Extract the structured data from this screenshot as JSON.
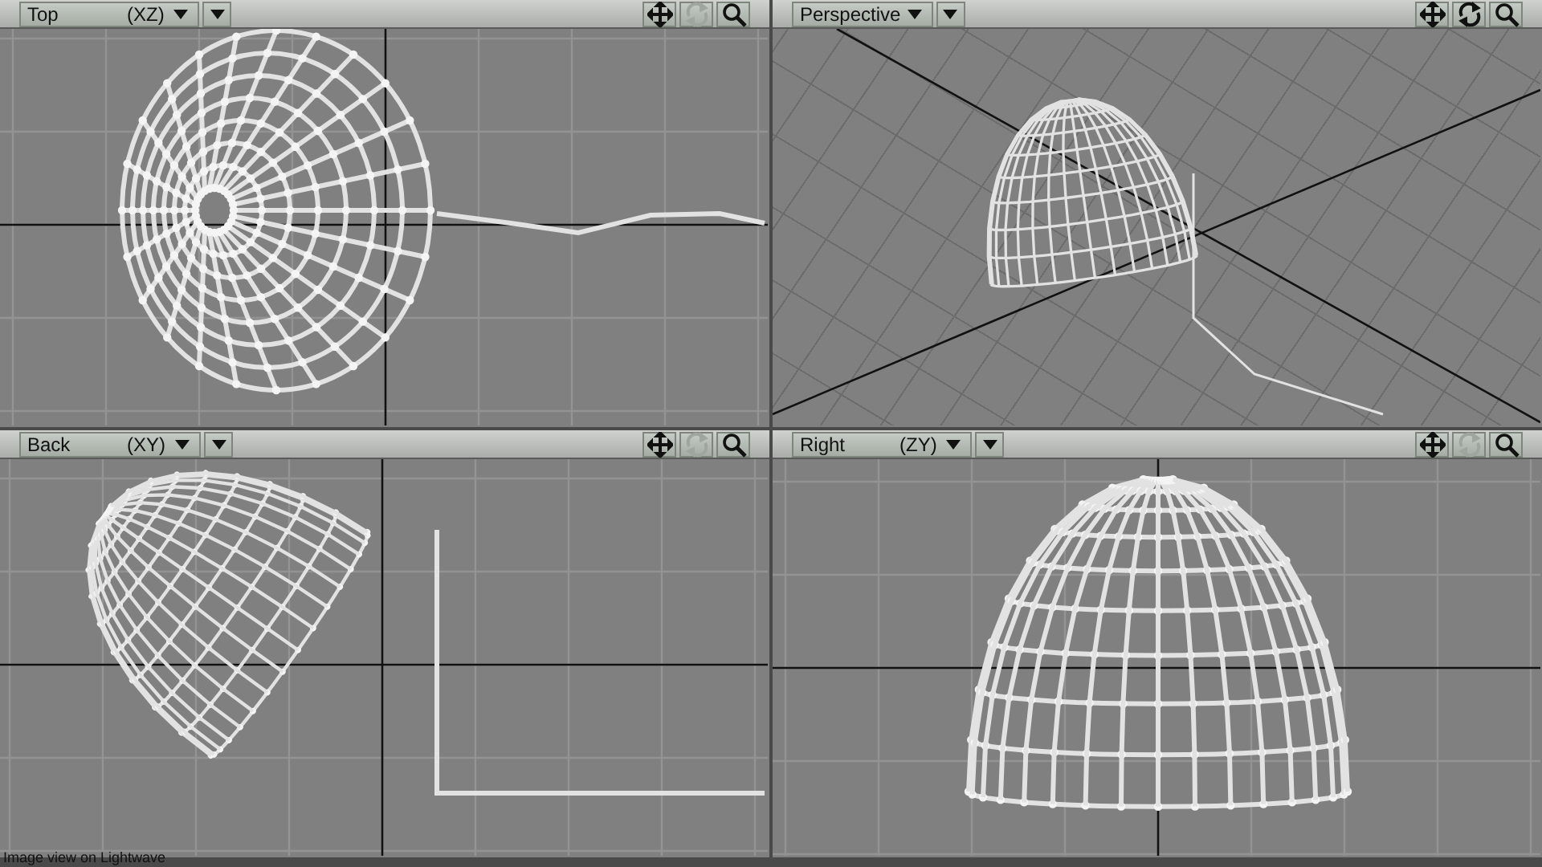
{
  "viewports": [
    {
      "kind": "orthographic",
      "title": "Top",
      "axes": "(XZ)",
      "rotate_disabled": true
    },
    {
      "kind": "perspective",
      "title": "Perspective",
      "rotate_disabled": false
    },
    {
      "kind": "orthographic",
      "title": "Back",
      "axes": "(XY)",
      "rotate_disabled": true
    },
    {
      "kind": "orthographic",
      "title": "Right",
      "axes": "(ZY)",
      "rotate_disabled": true
    }
  ],
  "caption": "Image view on Lightwave"
}
